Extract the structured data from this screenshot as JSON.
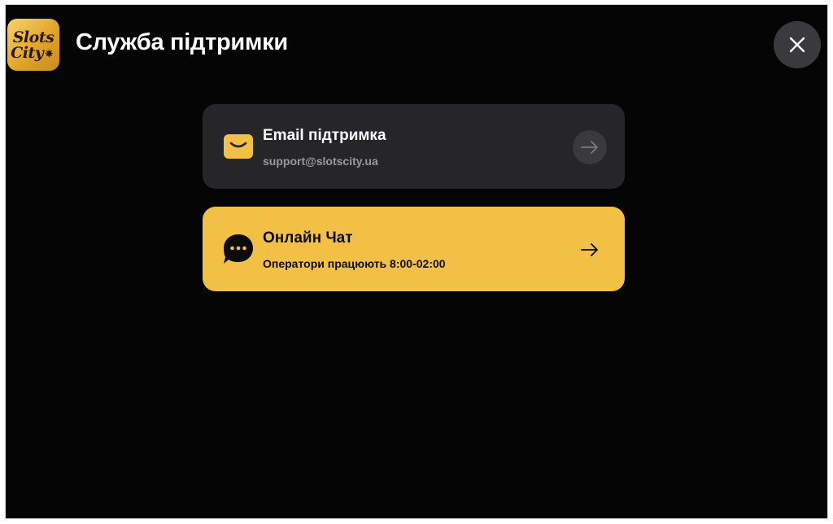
{
  "header": {
    "logo": {
      "line1": "Slots",
      "line2": "City",
      "star": "✵"
    },
    "title": "Служба підтримки",
    "close_icon": "close-icon"
  },
  "contacts": [
    {
      "title": "Email підтримка",
      "subtitle": "support@slotscity.ua",
      "icon": "envelope-icon",
      "background": "#262628",
      "accent": "#f1c044"
    },
    {
      "title": "Онлайн Чат",
      "subtitle": "Оператори працюють 8:00-02:00",
      "icon": "chat-bubble-icon",
      "background": "#f1c044",
      "accent": "#0c0c0c"
    }
  ]
}
